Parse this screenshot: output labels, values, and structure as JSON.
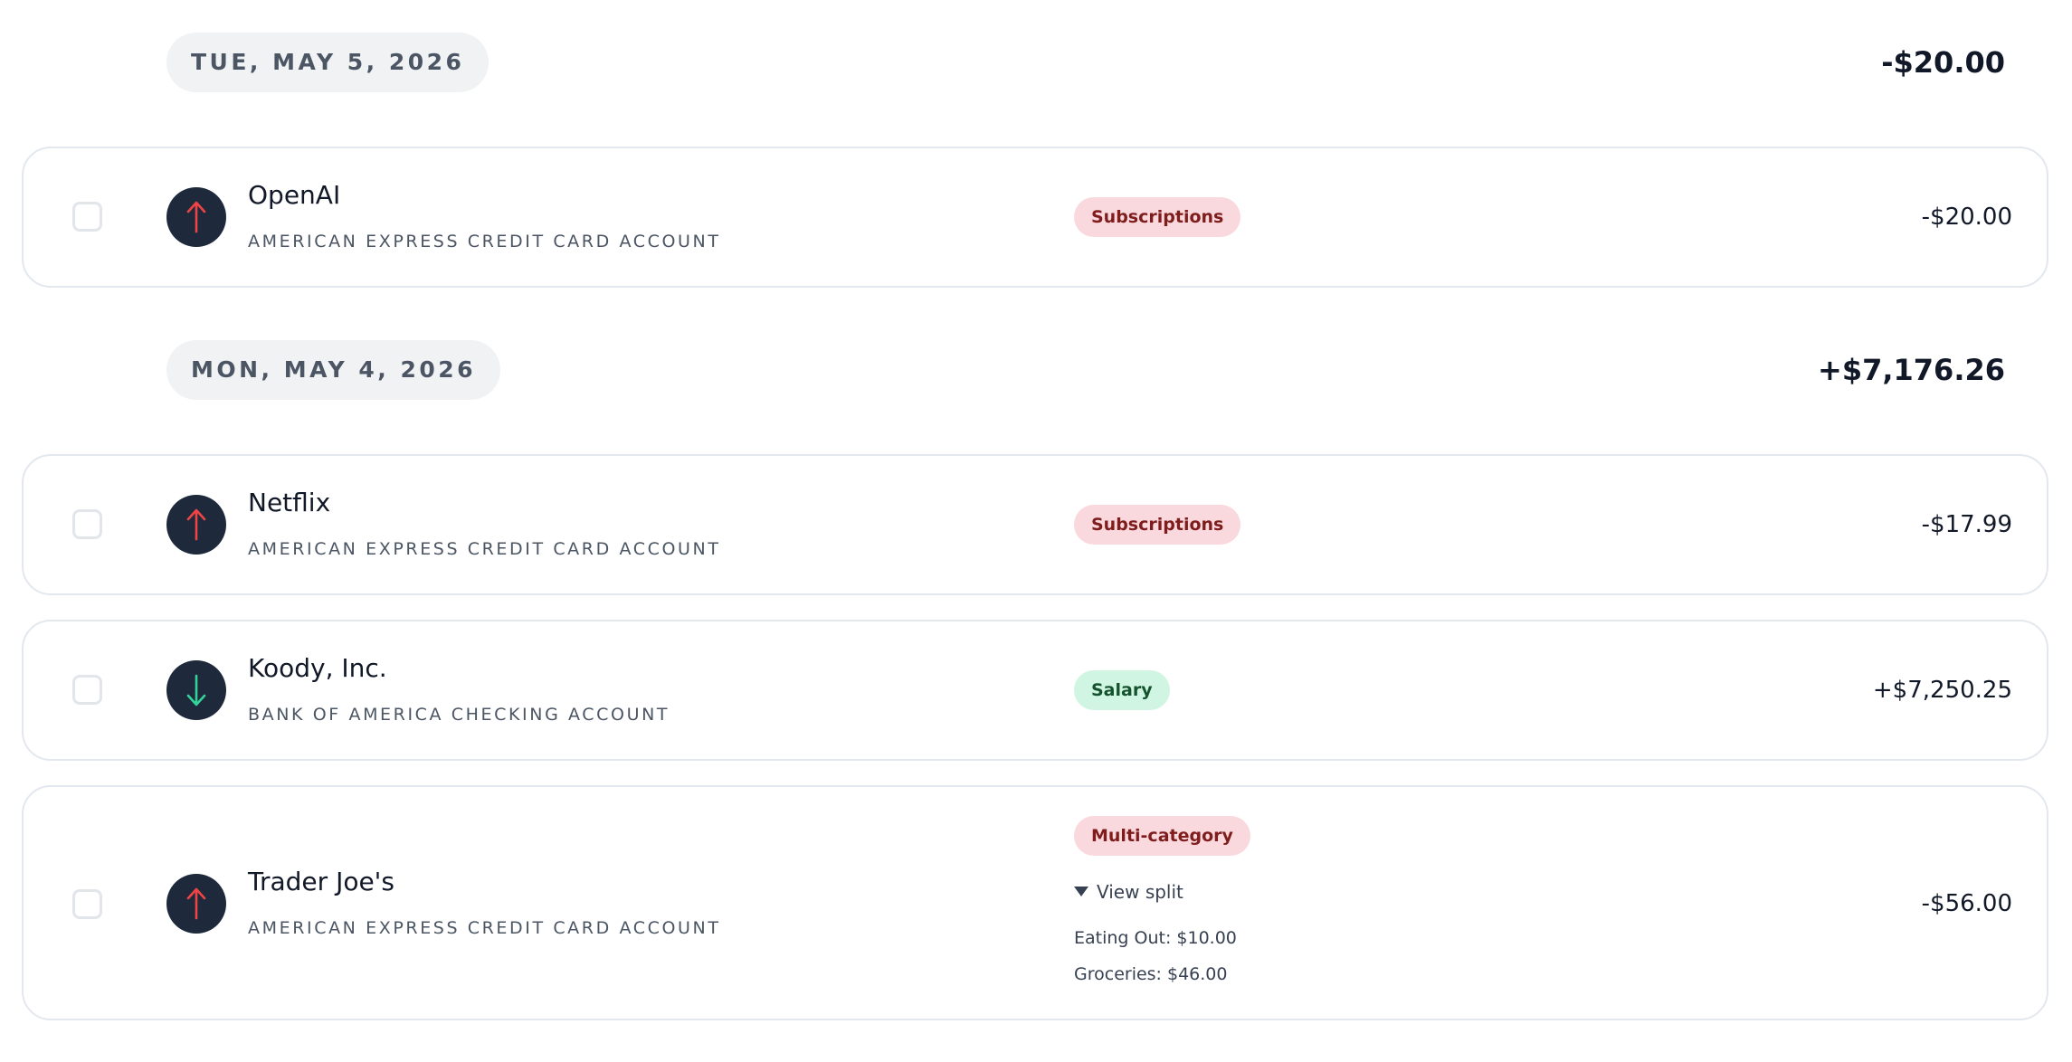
{
  "groups": [
    {
      "date": "TUE, MAY 5, 2026",
      "total": "-$20.00",
      "transactions": [
        {
          "merchant": "OpenAI",
          "account": "AMERICAN EXPRESS CREDIT CARD ACCOUNT",
          "direction": "outflow",
          "icon": "arrow-up-icon",
          "category": "Subscriptions",
          "amount": "-$20.00"
        }
      ]
    },
    {
      "date": "MON, MAY 4, 2026",
      "total": "+$7,176.26",
      "transactions": [
        {
          "merchant": "Netflix",
          "account": "AMERICAN EXPRESS CREDIT CARD ACCOUNT",
          "direction": "outflow",
          "icon": "arrow-up-icon",
          "category": "Subscriptions",
          "amount": "-$17.99"
        },
        {
          "merchant": "Koody, Inc.",
          "account": "BANK OF AMERICA CHECKING ACCOUNT",
          "direction": "inflow",
          "icon": "arrow-down-icon",
          "category": "Salary",
          "amount": "+$7,250.25"
        },
        {
          "merchant": "Trader Joe's",
          "account": "AMERICAN EXPRESS CREDIT CARD ACCOUNT",
          "direction": "outflow",
          "icon": "arrow-up-icon",
          "category": "Multi-category",
          "amount": "-$56.00",
          "view_split_label": "View split",
          "splits": [
            "Eating Out: $10.00",
            "Groceries: $46.00"
          ]
        }
      ]
    }
  ],
  "colors": {
    "outflow_arrow": "#ef4444",
    "inflow_arrow": "#34d399",
    "icon_bg": "#1e2a3c",
    "badge_red_bg": "#fad9de",
    "badge_red_text": "#7f1d1d",
    "badge_green_bg": "#d1f5e3",
    "badge_green_text": "#14532d",
    "date_pill_bg": "#f1f2f4"
  }
}
